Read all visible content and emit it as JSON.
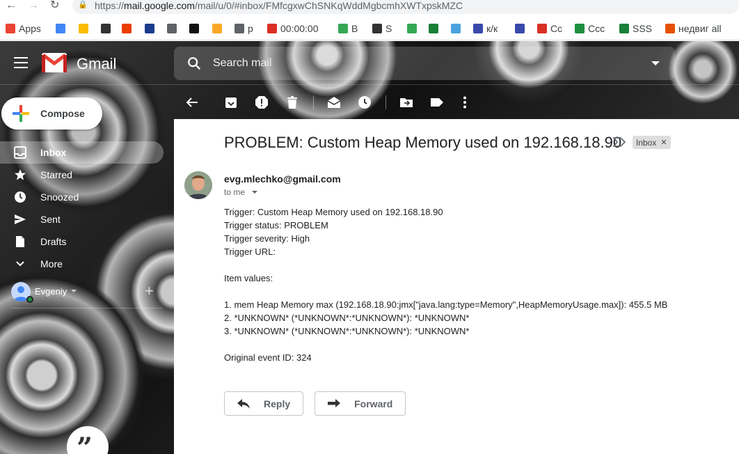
{
  "browser": {
    "url_prefix": "https://",
    "url_host": "mail.google.com",
    "url_path": "/mail/u/0/#inbox/FMfcgxwChSNKqWddMgbcmhXWTxpskMZC",
    "bookmarks": [
      {
        "label": "Apps",
        "icon": "apps-grid-icon",
        "color": "#ea4335"
      },
      {
        "label": "",
        "icon": "translate-icon",
        "color": "#4285f4"
      },
      {
        "label": "",
        "icon": "drive-icon",
        "color": "#fbbc04"
      },
      {
        "label": "",
        "icon": "globe-icon",
        "color": "#333333"
      },
      {
        "label": "",
        "icon": "office-icon",
        "color": "#eb3c00"
      },
      {
        "label": "",
        "icon": "weather-channel-icon",
        "color": "#1a3c8e"
      },
      {
        "label": "",
        "icon": "folder-icon",
        "color": "#5f6368"
      },
      {
        "label": "",
        "icon": "ff-icon",
        "color": "#111111"
      },
      {
        "label": "",
        "icon": "orange-circle-icon",
        "color": "#f9a825"
      },
      {
        "label": "p",
        "icon": "folder-icon",
        "color": "#5f6368"
      },
      {
        "label": "00:00:00",
        "icon": "updown-arrows-icon",
        "color": "#d93025"
      },
      {
        "label": "B",
        "icon": "drive-icon",
        "color": "#34a853"
      },
      {
        "label": "S",
        "icon": "globe-icon",
        "color": "#333333"
      },
      {
        "label": "",
        "icon": "maps-icon",
        "color": "#34a853"
      },
      {
        "label": "",
        "icon": "code-icon",
        "color": "#188038"
      },
      {
        "label": "",
        "icon": "blue-box-icon",
        "color": "#4aa3df"
      },
      {
        "label": "к/к",
        "icon": "globe-icon",
        "color": "#3949ab"
      },
      {
        "label": "",
        "icon": "globe-icon",
        "color": "#3949ab"
      },
      {
        "label": "Cc",
        "icon": "info-icon",
        "color": "#d93025"
      },
      {
        "label": "Ccc",
        "icon": "sheets-icon",
        "color": "#1e8e3e"
      },
      {
        "label": "SSS",
        "icon": "sheets-plus-icon",
        "color": "#188038"
      },
      {
        "label": "недвиг all",
        "icon": "face-icon",
        "color": "#e65100"
      }
    ]
  },
  "gmail": {
    "logo_text": "Gmail",
    "search_placeholder": "Search mail",
    "compose_label": "Compose",
    "nav": [
      {
        "label": "Inbox",
        "icon": "inbox-icon",
        "active": true
      },
      {
        "label": "Starred",
        "icon": "star-icon",
        "active": false
      },
      {
        "label": "Snoozed",
        "icon": "clock-icon",
        "active": false
      },
      {
        "label": "Sent",
        "icon": "send-icon",
        "active": false
      },
      {
        "label": "Drafts",
        "icon": "draft-icon",
        "active": false
      },
      {
        "label": "More",
        "icon": "chevron-down-icon",
        "active": false
      }
    ],
    "account_name": "Evgeniy"
  },
  "email": {
    "subject": "PROBLEM: Custom Heap Memory used on 192.168.18.90",
    "label_badge": "Inbox",
    "sender": "evg.mlechko@gmail.com",
    "to": "to me",
    "body_lines": [
      "Trigger: Custom Heap Memory used on 192.168.18.90",
      "Trigger status: PROBLEM",
      "Trigger severity: High",
      "Trigger URL:",
      "",
      "Item values:",
      "",
      "1. mem Heap Memory max (192.168.18.90:jmx[\"java.lang:type=Memory\",HeapMemoryUsage.max]): 455.5 MB",
      "2. *UNKNOWN* (*UNKNOWN*:*UNKNOWN*): *UNKNOWN*",
      "3. *UNKNOWN* (*UNKNOWN*:*UNKNOWN*): *UNKNOWN*",
      "",
      "Original event ID: 324"
    ],
    "reply_label": "Reply",
    "forward_label": "Forward"
  },
  "colors": {
    "accent_red": "#ea4335",
    "online_green": "#1e8e3e"
  }
}
